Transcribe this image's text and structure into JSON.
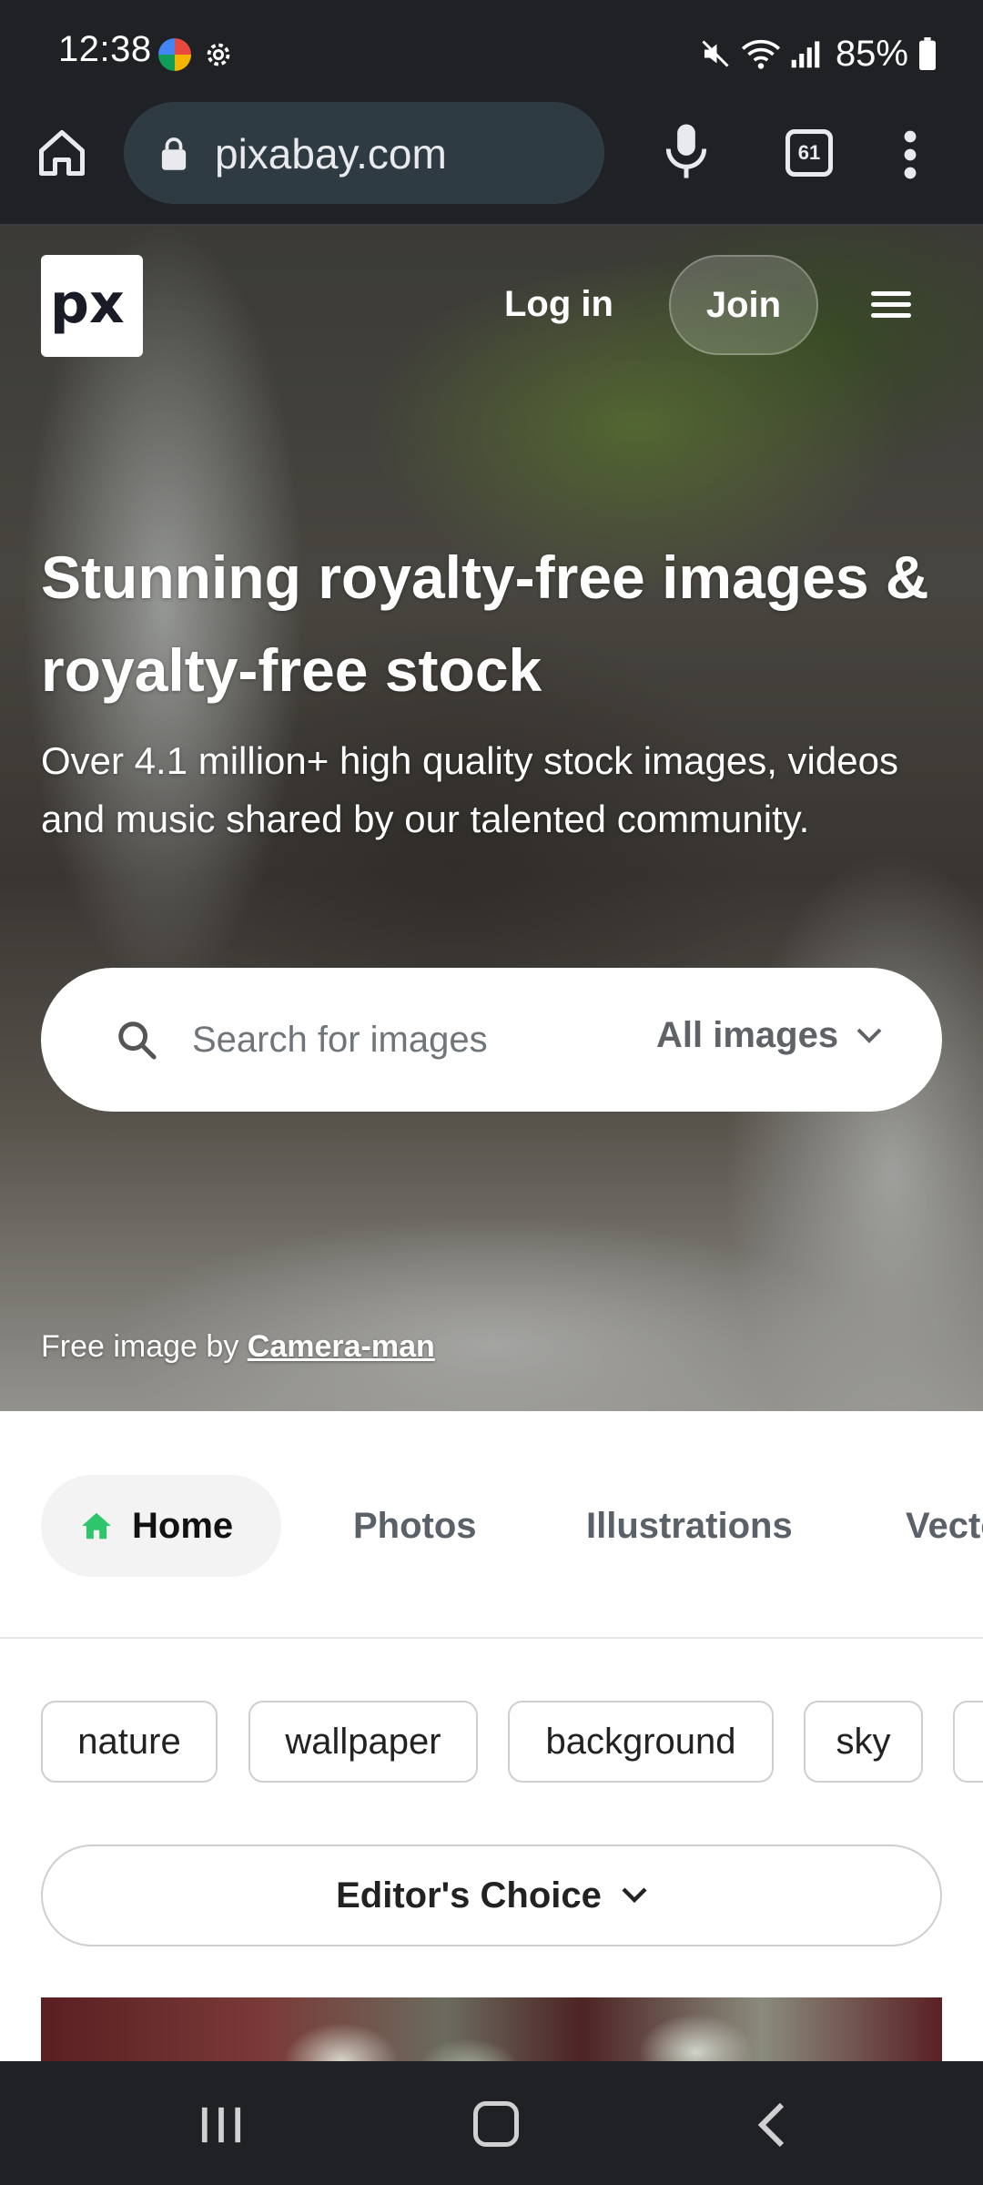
{
  "status_bar": {
    "time": "12:38",
    "battery": "85%",
    "icons": [
      "app-notification-icon",
      "settings-gear-icon",
      "mute-icon",
      "wifi-icon",
      "signal-icon",
      "battery-icon"
    ]
  },
  "browser": {
    "url": "pixabay.com",
    "tab_count": "61",
    "icons": [
      "home-icon",
      "lock-icon",
      "microphone-icon",
      "tabs-icon",
      "more-vert-icon"
    ]
  },
  "header": {
    "logo_text": "px",
    "login_label": "Log in",
    "join_label": "Join"
  },
  "hero": {
    "title": "Stunning royalty-free images & royalty-free stock",
    "subtitle": "Over 4.1 million+ high quality stock images, videos and music shared by our talented community.",
    "search_placeholder": "Search for images",
    "search_type": "All images",
    "credit_prefix": "Free image by",
    "credit_author": "Camera-man"
  },
  "tabs": [
    {
      "label": "Home",
      "active": true
    },
    {
      "label": "Photos",
      "active": false
    },
    {
      "label": "Illustrations",
      "active": false
    },
    {
      "label": "Vecto",
      "active": false
    }
  ],
  "chips": [
    "nature",
    "wallpaper",
    "background",
    "sky"
  ],
  "sort": {
    "label": "Editor's Choice"
  },
  "colors": {
    "chrome_dark": "#1f2124",
    "url_pill": "#2f3b43",
    "home_icon_green": "#2ec66d",
    "tab_inactive": "#5b6168"
  }
}
